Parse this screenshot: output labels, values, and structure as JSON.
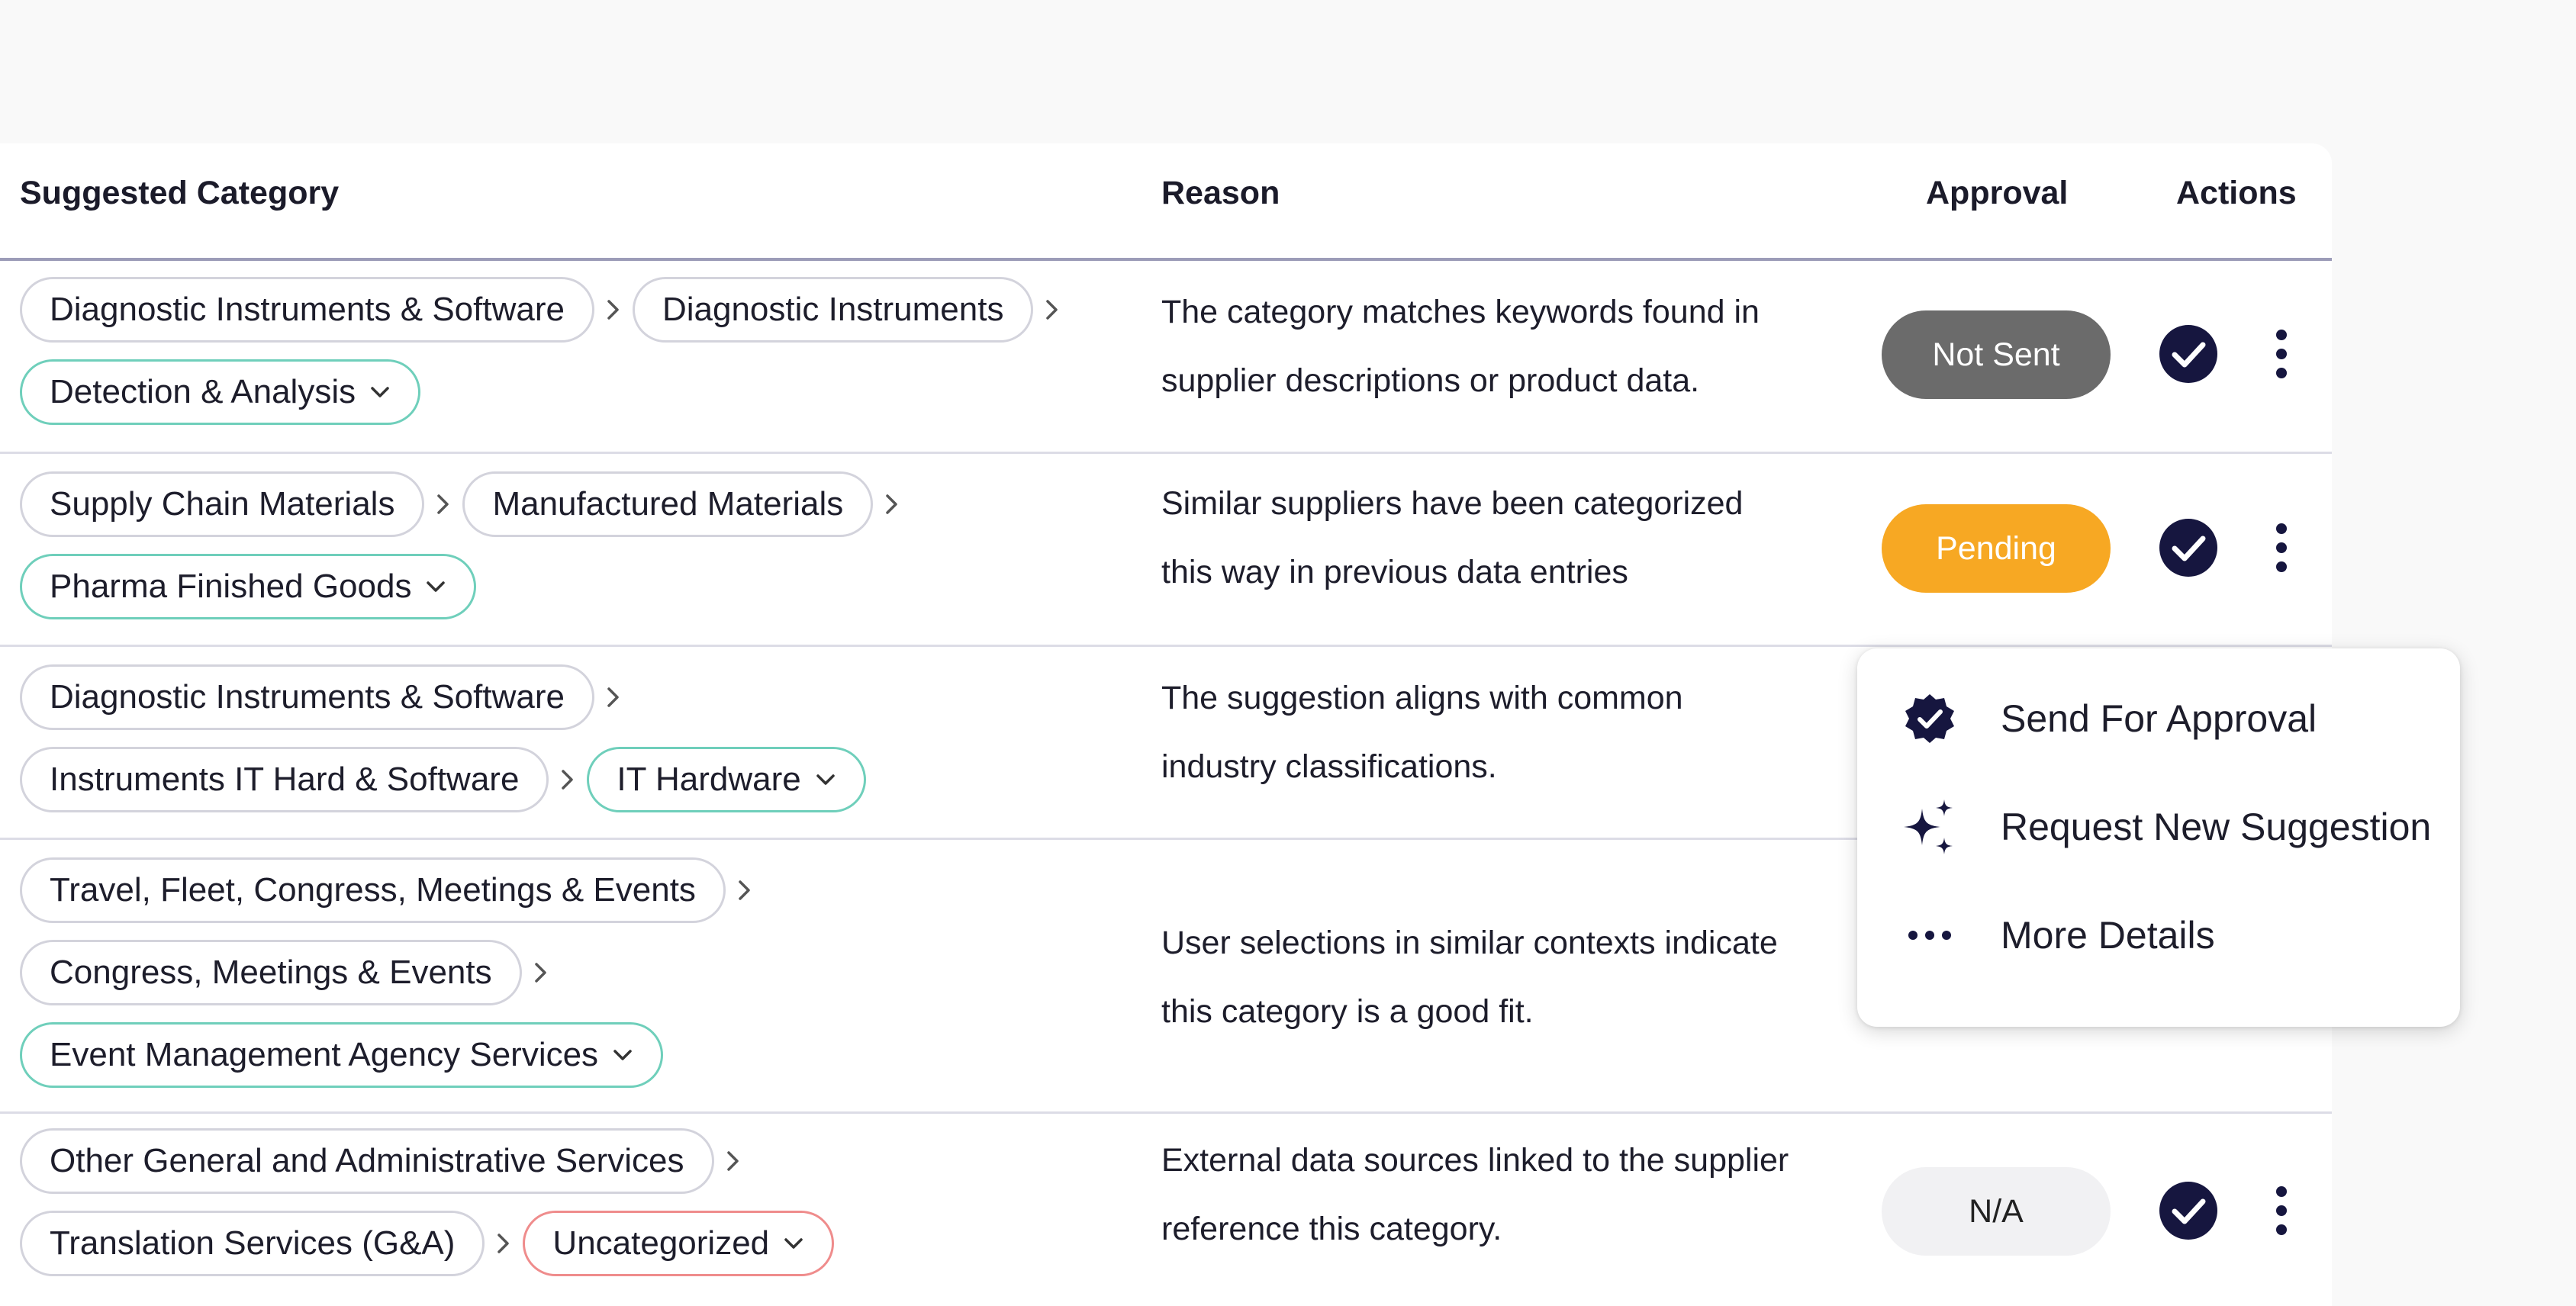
{
  "table": {
    "columns": {
      "category": "Suggested Category",
      "reason": "Reason",
      "approval": "Approval",
      "actions": "Actions"
    },
    "rows": [
      {
        "path": [
          "Diagnostic Instruments & Software",
          "Diagnostic Instruments"
        ],
        "leaf": "Detection & Analysis",
        "reason_lines": [
          "The category matches keywords found in",
          "supplier descriptions or product data."
        ],
        "approval": "Not Sent"
      },
      {
        "path": [
          "Supply Chain Materials",
          "Manufactured Materials"
        ],
        "leaf": "Pharma Finished Goods",
        "reason_lines": [
          "Similar suppliers have been categorized",
          "this way in previous data entries"
        ],
        "approval": "Pending"
      },
      {
        "path": [
          "Diagnostic Instruments & Software",
          "Instruments IT Hard & Software"
        ],
        "leaf": "IT Hardware",
        "reason_lines": [
          "The suggestion aligns with common",
          "industry classifications."
        ],
        "approval": ""
      },
      {
        "path": [
          "Travel, Fleet, Congress, Meetings & Events",
          "Congress, Meetings & Events"
        ],
        "leaf": "Event Management Agency Services",
        "reason_lines": [
          "User selections in similar contexts indicate",
          "this category is a good fit."
        ],
        "approval": ""
      },
      {
        "path": [
          "Other General and Administrative Services",
          "Translation Services (G&A)"
        ],
        "leaf": "Uncategorized",
        "reason_lines": [
          "External data sources linked to the supplier",
          "reference this category."
        ],
        "approval": "N/A"
      }
    ]
  },
  "context_menu": {
    "items": [
      {
        "label": "Send For Approval",
        "icon": "verified-badge-icon"
      },
      {
        "label": "Request New Suggestion",
        "icon": "sparkles-icon"
      },
      {
        "label": "More Details",
        "icon": "more-horizontal-icon"
      }
    ]
  },
  "colors": {
    "navy": "#16163f",
    "leaf_border": "#6fcfbb",
    "uncategorized_border": "#ef8c8c",
    "not_sent": "#6b6b6b",
    "pending": "#f7a823",
    "na_bg": "#f1f1f3",
    "header_rule": "#9c9cb8"
  }
}
